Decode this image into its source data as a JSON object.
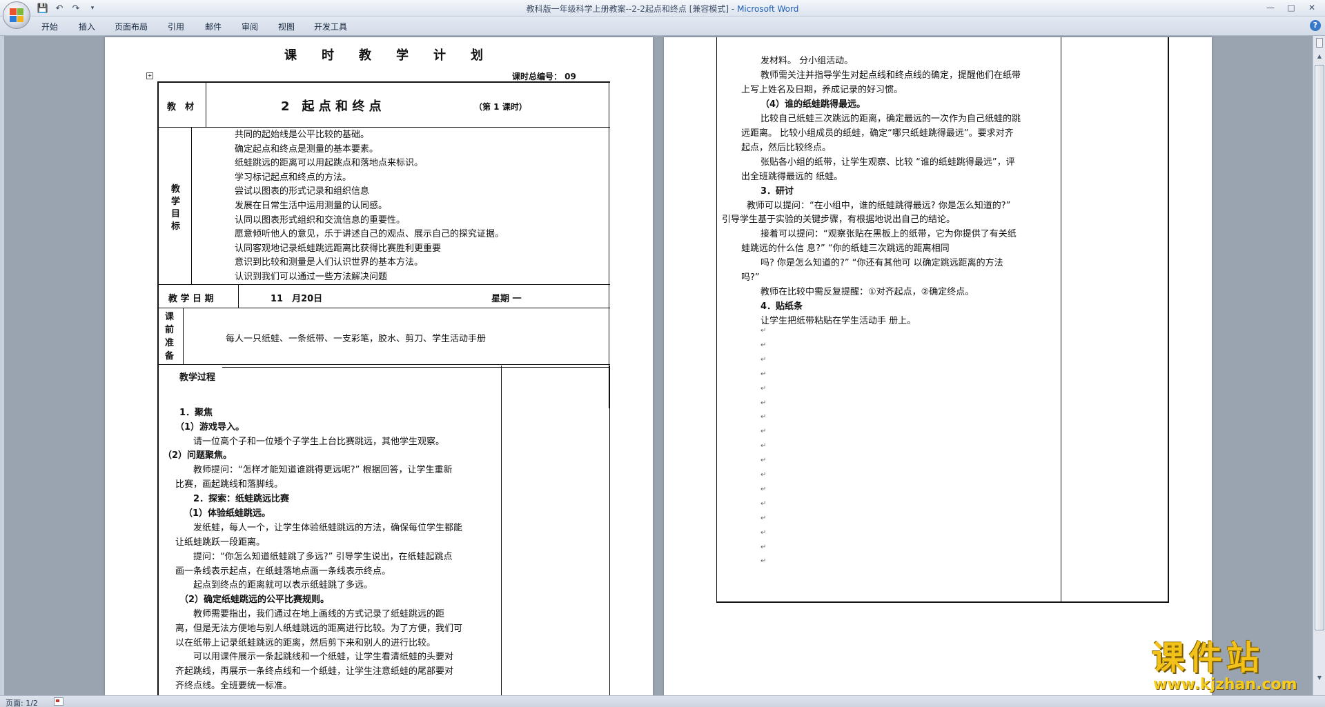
{
  "window": {
    "title": "教科版一年级科学上册教案--2-2起点和终点 [兼容模式]",
    "title_sep": " - ",
    "app_name": "Microsoft Word"
  },
  "ribbon": {
    "tabs": [
      "开始",
      "插入",
      "页面布局",
      "引用",
      "邮件",
      "审阅",
      "视图",
      "开发工具"
    ]
  },
  "status": {
    "page": "页面: 1/2"
  },
  "icons": {
    "office": "office-logo-icon",
    "save": "save-icon",
    "undo": "undo-icon",
    "redo": "redo-icon",
    "customize": "dropdown-icon",
    "help": "help-icon"
  },
  "colors": {
    "accent": "#1e5fb4",
    "ribbon": "#dde4ee",
    "watermark": "#f2c21a"
  },
  "page1": {
    "doc_title": "课　　时　　教　　学　　计　　划",
    "lesson_no": "课时总编号： 09",
    "material_label": "教　材",
    "lesson_title": "2　起 点 和 终 点",
    "period": "（第 1 课时）",
    "goals_label": [
      "教",
      "学",
      "目",
      "标"
    ],
    "goals": [
      "共同的起始线是公平比较的基础。",
      "确定起点和终点是测量的基本要素。",
      "纸蛙跳远的距离可以用起跳点和落地点来标识。",
      "学习标记起点和终点的方法。",
      "尝试以图表的形式记录和组织信息",
      "发展在日常生活中运用测量的认同感。",
      "认同以图表形式组织和交流信息的重要性。",
      "愿意倾听他人的意见，乐于讲述自己的观点、展示自己的探究证据。",
      "认同客观地记录纸蛙跳远距离比获得比赛胜利更重要",
      "意识到比较和测量是人们认识世界的基本方法。",
      "认识到我们可以通过一些方法解决问题"
    ],
    "date_label": "教 学 日 期",
    "date": "11　月20日",
    "weekday": "星期 一",
    "prep_label": [
      "课",
      "前",
      "准",
      "备"
    ],
    "prep": "每人一只纸蛙、一条纸带、一支彩笔，胶水、剪刀、学生活动手册",
    "process": [
      "教学过程",
      "1．聚焦",
      "（1）游戏导入。",
      "请一位高个子和一位矮个子学生上台比赛跳远，其他学生观察。",
      "（2）问题聚焦。",
      "教师提问：“怎样才能知道谁跳得更远呢?” 根据回答，让学生重新",
      "比赛，画起跳线和落脚线。",
      "2．探索：纸蛙跳远比赛",
      "（1）体验纸蛙跳远。",
      "发纸蛙，每人一个，让学生体验纸蛙跳远的方法，确保每位学生都能",
      "让纸蛙跳跃一段距离。",
      "提问：“你怎么知道纸蛙跳了多远?” 引导学生说出，在纸蛙起跳点",
      "画一条线表示起点，在纸蛙落地点画一条线表示终点。",
      "起点到终点的距离就可以表示纸蛙跳了多远。",
      "（2）确定纸蛙跳远的公平比赛规则。",
      "教师需要指出，我们通过在地上画线的方式记录了纸蛙跳远的距",
      "离，但是无法方便地与别人纸蛙跳远的距离进行比较。为了方便，我们可",
      "以在纸带上记录纸蛙跳远的距离，然后剪下来和别人的进行比较。",
      "可以用课件展示一条起跳线和一个纸蛙，让学生看清纸蛙的头要对",
      "齐起跳线，再展示一条终点线和一个纸蛙，让学生注意纸蛙的尾部要对",
      "齐终点线。全班要统一标准。"
    ]
  },
  "page2": {
    "lines": [
      "发材料。 分小组活动。",
      "教师需关注并指导学生对起点线和终点线的确定，提醒他们在纸带",
      "上写上姓名及日期，养成记录的好习惯。",
      "（4）谁的纸蛙跳得最远。",
      "比较自己纸蛙三次跳远的距离，确定最远的一次作为自己纸蛙的跳",
      "远距离。 比较小组成员的纸蛙，确定“哪只纸蛙跳得最远”。要求对齐",
      "起点，然后比较终点。",
      "张贴各小组的纸带，让学生观察、比较 “谁的纸蛙跳得最远”，评",
      "出全班跳得最远的 纸蛙。",
      "3．研讨",
      "教师可以提问：“在小组中，谁的纸蛙跳得最远? 你是怎么知道的?”",
      "引导学生基于实验的关键步骤，有根据地说出自己的结论。",
      "接着可以提问：“观察张贴在黑板上的纸带，它为你提供了有关纸",
      "蛙跳远的什么信 息?” “你的纸蛙三次跳远的距离相同",
      "吗? 你是怎么知道的?” “你还有其他可 以确定跳远距离的方法",
      "吗?”",
      "教师在比较中需反复提醒：①对齐起点，②确定终点。",
      "4．贴纸条",
      "让学生把纸带粘贴在学生活动手 册上。"
    ]
  },
  "watermark": {
    "text": "课件站",
    "url": "www.kjzhan.com"
  }
}
